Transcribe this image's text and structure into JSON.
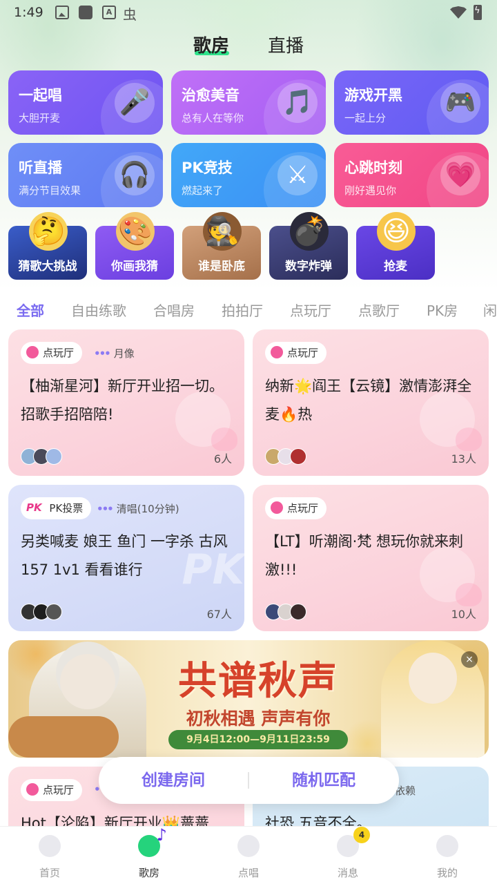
{
  "status_bar": {
    "time": "1:49",
    "bug_glyph": "虫"
  },
  "top_tabs": [
    {
      "label": "歌房",
      "active": true
    },
    {
      "label": "直播",
      "active": false
    }
  ],
  "categories": [
    {
      "title": "一起唱",
      "subtitle": "大胆开麦",
      "icon": "microphone-icon",
      "color": "#7d5cf5"
    },
    {
      "title": "治愈美音",
      "subtitle": "总有人在等你",
      "icon": "music-note-icon",
      "color": "#b86cf6"
    },
    {
      "title": "游戏开黑",
      "subtitle": "一起上分",
      "icon": "gamepad-icon",
      "color": "#6a6cf7"
    },
    {
      "title": "听直播",
      "subtitle": "满分节目效果",
      "icon": "headphones-icon",
      "color": "#6a8ef6"
    },
    {
      "title": "PK竞技",
      "subtitle": "燃起来了",
      "icon": "crossed-swords-icon",
      "color": "#3f9ef7"
    },
    {
      "title": "心跳时刻",
      "subtitle": "刚好遇见你",
      "icon": "heart-icon",
      "color": "#f3508c"
    }
  ],
  "games": [
    {
      "label": "猜歌大挑战",
      "icon": "thinking-face-headphones-icon"
    },
    {
      "label": "你画我猜",
      "icon": "paint-palette-icon"
    },
    {
      "label": "谁是卧底",
      "icon": "detective-hat-icon"
    },
    {
      "label": "数字炸弹",
      "icon": "bomb-icon"
    },
    {
      "label": "抢麦",
      "icon": "excited-face-icon"
    }
  ],
  "filter_tabs": [
    "全部",
    "自由练歌",
    "合唱房",
    "拍拍厅",
    "点玩厅",
    "点歌厅",
    "PK房",
    "闲"
  ],
  "rooms": [
    {
      "tag": "点玩厅",
      "tag_type": "play",
      "song": "月像",
      "title": "【柚渐星河】新厅开业招一切。招歌手招陪陪!",
      "count": "6人"
    },
    {
      "tag": "点玩厅",
      "tag_type": "play",
      "song": "",
      "title": "纳新🌟阎王【云镜】激情澎湃全麦🔥热",
      "count": "13人"
    },
    {
      "tag": "PK投票",
      "tag_type": "pk",
      "tag_prefix": "PK",
      "song": "清唱(10分钟)",
      "title": "另类喊麦 娘王 鱼门 一字杀 古风 157 1v1 看看谁行",
      "count": "67人"
    },
    {
      "tag": "点玩厅",
      "tag_type": "play",
      "song": "",
      "title": "【LT】听潮阁·梵 想玩你就来刺激!!!",
      "count": "10人"
    }
  ],
  "banner": {
    "title": "共谱秋声",
    "subtitle": "初秋相遇  声声有你",
    "date": "9月4日12:00—9月11日23:59",
    "close": "×"
  },
  "partial_rooms": [
    {
      "tag": "点玩厅",
      "title": "Hot【沦陷】新厅开业👑蔷蔷"
    },
    {
      "song": "依赖",
      "title": "社恐,五音不全。"
    }
  ],
  "float_actions": {
    "create": "创建房间",
    "match": "随机匹配"
  },
  "bottom_nav": [
    {
      "label": "首页",
      "active": false
    },
    {
      "label": "歌房",
      "active": true
    },
    {
      "label": "点唱",
      "active": false
    },
    {
      "label": "消息",
      "active": false,
      "badge": "4"
    },
    {
      "label": "我的",
      "active": false
    }
  ],
  "colors": {
    "accent": "#7b6cf0",
    "green": "#2ee28a"
  }
}
